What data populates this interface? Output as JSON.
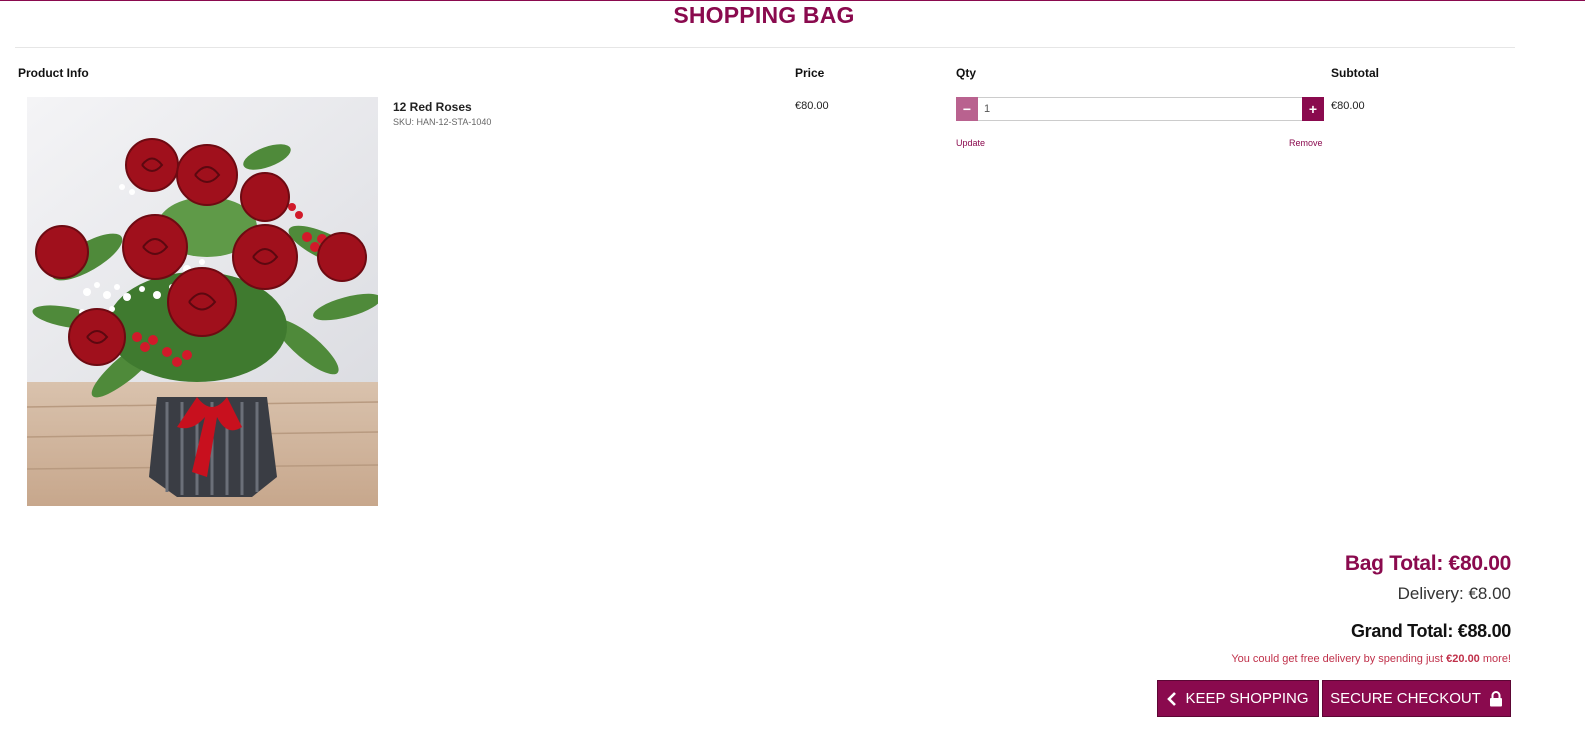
{
  "page": {
    "title": "SHOPPING BAG"
  },
  "table": {
    "headers": {
      "product": "Product Info",
      "price": "Price",
      "qty": "Qty",
      "subtotal": "Subtotal"
    }
  },
  "item": {
    "name": "12 Red Roses",
    "sku": "SKU: HAN-12-STA-1040",
    "price": "€80.00",
    "qty": "1",
    "subtotal": "€80.00",
    "update_label": "Update",
    "remove_label": "Remove",
    "minus_label": "−",
    "plus_label": "+"
  },
  "summary": {
    "bag_total": "Bag Total: €80.00",
    "delivery": "Delivery: €8.00",
    "grand_total": "Grand Total: €88.00",
    "free_delivery_prefix": "You could get free delivery by spending just ",
    "free_delivery_amount": "€20.00",
    "free_delivery_suffix": " more!"
  },
  "actions": {
    "keep_shopping": "KEEP SHOPPING",
    "keep_shopping_icon": "chevron-left-icon",
    "secure_checkout": "SECURE CHECKOUT",
    "secure_checkout_icon": "lock-icon"
  },
  "colors": {
    "brand": "#8a0a4e",
    "minus_button": "#b9628f",
    "free_delivery_text": "#c0304a"
  }
}
